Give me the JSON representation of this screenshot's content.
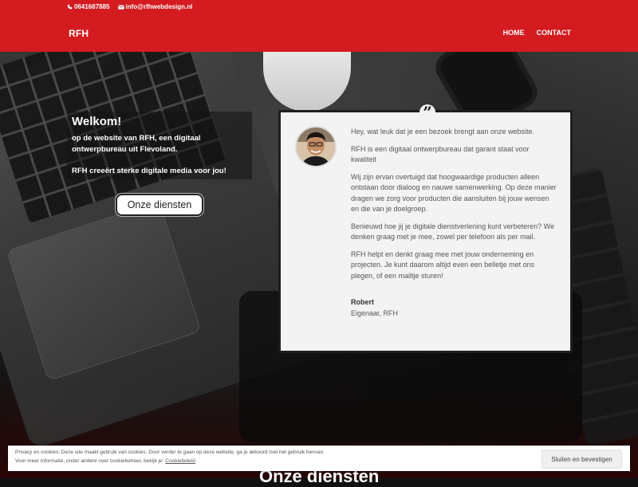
{
  "topbar": {
    "phone": "0641687885",
    "email": "info@rfhwebdesign.nl",
    "logo": "RFH",
    "nav": [
      {
        "label": "HOME"
      },
      {
        "label": "CONTACT"
      }
    ]
  },
  "hero": {
    "title": "Welkom!",
    "line1": "op de website van RFH, een digitaal ontwerpbureau uit Flevoland.",
    "line2": "RFH creeërt sterke digitale media voor jou!",
    "button": "Onze diensten"
  },
  "testimonial": {
    "quote_mark": "”",
    "paragraphs": [
      "Hey, wat leuk dat je een bezoek brengt aan onze website.",
      "RFH is een digitaal ontwerpbureau dat garant staat voor kwaliteit",
      "Wij zijn ervan overtuigd dat hoogwaardige producten alleen ontstaan door dialoog en nauwe samenwerking. Op deze manier dragen we zorg voor producten die aansluiten bij jouw wensen en die van je doelgroep.",
      "Benieuwd hoe jij je digitale dienstverlening kunt verbeteren? We denken graag met je mee, zowel per telefoon als per mail.",
      "RFH helpt en denkt graag mee met jouw onderneming en projecten. Je kunt daarom altijd even een belletje met ons plegen, of een mailtje sturen!"
    ],
    "author": "Robert",
    "role": "Eigenaar, RFH"
  },
  "next_section": {
    "title": "Onze diensten"
  },
  "cookie": {
    "line1": "Privacy en cookies: Deze site maakt gebruik van cookies. Door verder te gaan op deze website, ga je akkoord met het gebruik hiervan.",
    "line2_prefix": "Voor meer informatie, onder andere over cookiebeheer, bekijk je:",
    "link": "Cookiebeleid",
    "accept": "Sluiten en bevestigen"
  },
  "colors": {
    "brand_red": "#d41b1f"
  }
}
